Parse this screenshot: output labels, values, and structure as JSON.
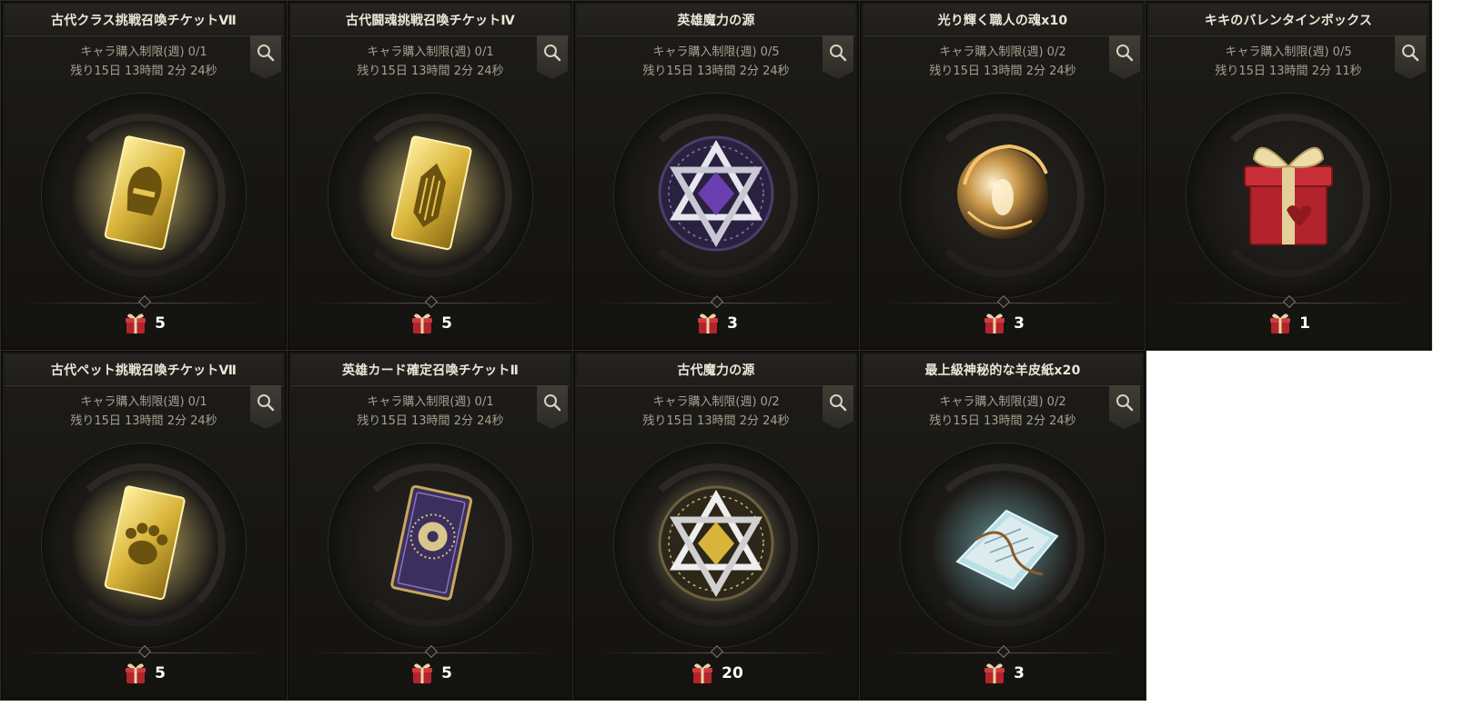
{
  "shop": {
    "items": [
      {
        "name": "古代クラス挑戦召喚チケットⅦ",
        "limit": "キャラ購入制限(週) 0/1",
        "timer": "残り15日 13時間 2分 24秒",
        "price": "5",
        "icon": "gold-class-ticket-icon"
      },
      {
        "name": "古代闘魂挑戦召喚チケットⅣ",
        "limit": "キャラ購入制限(週) 0/1",
        "timer": "残り15日 13時間 2分 24秒",
        "price": "5",
        "icon": "gold-fighting-spirit-ticket-icon"
      },
      {
        "name": "英雄魔力の源",
        "limit": "キャラ購入制限(週) 0/5",
        "timer": "残り15日 13時間 2分 24秒",
        "price": "3",
        "icon": "purple-magic-source-icon"
      },
      {
        "name": "光り輝く職人の魂x10",
        "limit": "キャラ購入制限(週) 0/2",
        "timer": "残り15日 13時間 2分 24秒",
        "price": "3",
        "icon": "craftsman-soul-orb-icon"
      },
      {
        "name": "キキのバレンタインボックス",
        "limit": "キャラ購入制限(週) 0/5",
        "timer": "残り15日 13時間 2分 11秒",
        "price": "1",
        "icon": "valentine-gift-box-icon"
      },
      {
        "name": "古代ペット挑戦召喚チケットⅦ",
        "limit": "キャラ購入制限(週) 0/1",
        "timer": "残り15日 13時間 2分 24秒",
        "price": "5",
        "icon": "gold-pet-ticket-icon"
      },
      {
        "name": "英雄カード確定召喚チケットⅡ",
        "limit": "キャラ購入制限(週) 0/1",
        "timer": "残り15日 13時間 2分 24秒",
        "price": "5",
        "icon": "hero-card-ticket-icon"
      },
      {
        "name": "古代魔力の源",
        "limit": "キャラ購入制限(週) 0/2",
        "timer": "残り15日 13時間 2分 24秒",
        "price": "20",
        "icon": "gold-magic-source-icon"
      },
      {
        "name": "最上級神秘的な羊皮紙x20",
        "limit": "キャラ購入制限(週) 0/2",
        "timer": "残り15日 13時間 2分 24秒",
        "price": "3",
        "icon": "mystic-parchment-icon"
      }
    ],
    "currency_icon": "gift-box-currency-icon",
    "search_icon": "magnifier-icon",
    "colors": {
      "card_bg": "#1a1916",
      "title_text": "#ece6d8",
      "sub_text": "#a7a091",
      "price_text": "#ffffff",
      "gold": "#d9b43a",
      "purple": "#6a3fb0",
      "gift_red": "#b3232c"
    }
  }
}
